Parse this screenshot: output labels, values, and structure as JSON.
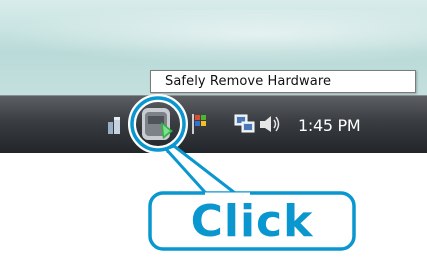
{
  "tooltip": {
    "text": "Safely Remove Hardware"
  },
  "taskbar": {
    "clock": "1:45 PM",
    "tray_icons": [
      "system-icon",
      "safely-remove-hardware-icon",
      "flag-icon",
      "network-icon",
      "volume-icon"
    ]
  },
  "callout": {
    "label": "Click",
    "color": "#0a96cf"
  }
}
